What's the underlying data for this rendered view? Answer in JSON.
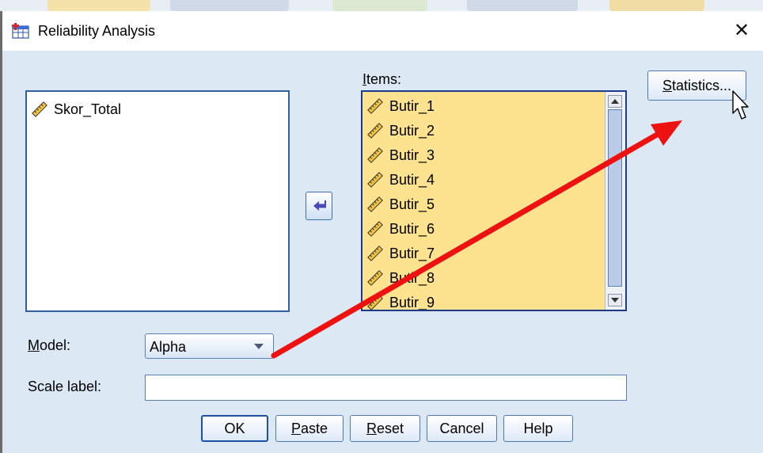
{
  "window": {
    "title": "Reliability Analysis",
    "close_glyph": "✕"
  },
  "variables": {
    "items": [
      {
        "label": "Skor_Total"
      }
    ]
  },
  "items_list": {
    "label_u": "I",
    "label_rest": "tems:",
    "items": [
      {
        "label": "Butir_1"
      },
      {
        "label": "Butir_2"
      },
      {
        "label": "Butir_3"
      },
      {
        "label": "Butir_4"
      },
      {
        "label": "Butir_5"
      },
      {
        "label": "Butir_6"
      },
      {
        "label": "Butir_7"
      },
      {
        "label": "Butir_8"
      },
      {
        "label": "Butir_9"
      }
    ]
  },
  "model": {
    "label_u": "M",
    "label_rest": "odel:",
    "value": "Alpha"
  },
  "scale_label": {
    "label": "Scale label:",
    "value": ""
  },
  "statistics_button": {
    "label_u": "S",
    "label_rest": "tatistics..."
  },
  "buttons": {
    "ok": "OK",
    "paste_u": "P",
    "paste_rest": "aste",
    "reset_u": "R",
    "reset_rest": "eset",
    "cancel": "Cancel",
    "help": "Help"
  },
  "colors": {
    "annotation_arrow": "#ee1111",
    "items_bg": "#fde28f",
    "dialog_bg": "#dce8f4"
  },
  "icons": [
    "app-icon",
    "ruler-icon",
    "move-left-arrow-icon",
    "dropdown-arrow-icon",
    "mouse-cursor-icon",
    "close-icon"
  ]
}
